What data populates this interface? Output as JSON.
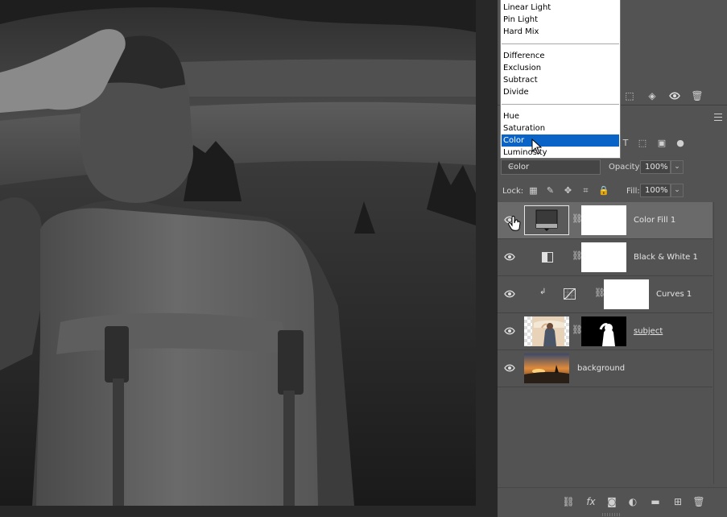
{
  "blend_menu": {
    "groups": [
      [
        "Linear Light",
        "Pin Light",
        "Hard Mix"
      ],
      [
        "Difference",
        "Exclusion",
        "Subtract",
        "Divide"
      ],
      [
        "Hue",
        "Saturation",
        "Color",
        "Luminosity"
      ]
    ],
    "highlighted": "Color"
  },
  "layers_panel": {
    "blend_mode": "Color",
    "opacity_label": "Opacity:",
    "opacity_value": "100%",
    "lock_label": "Lock:",
    "fill_label": "Fill:",
    "fill_value": "100%",
    "layers": [
      {
        "name": "Color Fill 1",
        "selected": true
      },
      {
        "name": "Black & White 1",
        "selected": false
      },
      {
        "name": "Curves 1",
        "selected": false
      },
      {
        "name": "subject",
        "selected": false
      },
      {
        "name": "background",
        "selected": false
      }
    ]
  },
  "icons": {
    "top_row": [
      "selection-icon",
      "mask-icon",
      "eye-icon",
      "trash-icon"
    ],
    "filter_row": [
      "type-filter-icon",
      "shape-filter-icon",
      "smart-object-filter-icon",
      "filter-toggle-icon"
    ],
    "lock_row": [
      "lock-transparent-icon",
      "lock-brush-icon",
      "lock-position-icon",
      "lock-artboard-icon",
      "lock-all-icon"
    ],
    "bottom_row": [
      "link-layers-icon",
      "fx-icon",
      "add-mask-icon",
      "adjustment-layer-icon",
      "new-group-icon",
      "new-layer-icon",
      "delete-layer-icon"
    ]
  },
  "colors": {
    "panel_bg": "#535353",
    "selected_layer": "#6a6a6a",
    "menu_highlight": "#0a64c8"
  }
}
